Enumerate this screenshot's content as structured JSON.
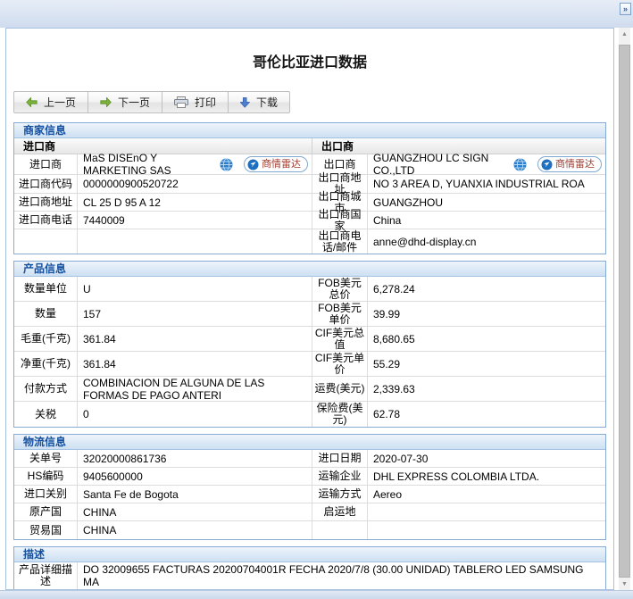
{
  "window": {
    "expand_glyph": "»"
  },
  "title": "哥伦比亚进口数据",
  "toolbar": {
    "prev_label": "上一页",
    "next_label": "下一页",
    "print_label": "打印",
    "download_label": "下载"
  },
  "merchant": {
    "section_title": "商家信息",
    "importer_group_header": "进口商",
    "exporter_group_header": "出口商",
    "radar_button_label": "商情雷达",
    "importer_rows": [
      {
        "label": "进口商",
        "value": "MaS DISEnO Y MARKETING SAS"
      },
      {
        "label": "进口商代码",
        "value": "0000000900520722"
      },
      {
        "label": "进口商地址",
        "value": "CL 25 D 95 A 12"
      },
      {
        "label": "进口商电话",
        "value": "7440009"
      }
    ],
    "exporter_rows": [
      {
        "label": "出口商",
        "value": "GUANGZHOU LC SIGN CO.,LTD"
      },
      {
        "label": "出口商地址",
        "value": "NO 3 AREA D, YUANXIA INDUSTRIAL ROA"
      },
      {
        "label": "出口商城市",
        "value": "GUANGZHOU"
      },
      {
        "label": "出口商国家",
        "value": "China"
      },
      {
        "label": "出口商电话/邮件",
        "value": "anne@dhd-display.cn"
      }
    ]
  },
  "product": {
    "section_title": "产品信息",
    "rows": [
      {
        "l1": "数量单位",
        "v1": "U",
        "l2": "FOB美元总价",
        "v2": "6,278.24"
      },
      {
        "l1": "数量",
        "v1": "157",
        "l2": "FOB美元单价",
        "v2": "39.99"
      },
      {
        "l1": "毛重(千克)",
        "v1": "361.84",
        "l2": "CIF美元总值",
        "v2": "8,680.65"
      },
      {
        "l1": "净重(千克)",
        "v1": "361.84",
        "l2": "CIF美元单价",
        "v2": "55.29"
      },
      {
        "l1": "付款方式",
        "v1": "COMBINACION DE ALGUNA DE LAS FORMAS DE PAGO ANTERI",
        "l2": "运费(美元)",
        "v2": "2,339.63"
      },
      {
        "l1": "关税",
        "v1": "0",
        "l2": "保险费(美元)",
        "v2": "62.78"
      }
    ]
  },
  "logistics": {
    "section_title": "物流信息",
    "rows": [
      {
        "l1": "关单号",
        "v1": "32020000861736",
        "l2": "进口日期",
        "v2": "2020-07-30"
      },
      {
        "l1": "HS编码",
        "v1": "9405600000",
        "l2": "运输企业",
        "v2": "DHL EXPRESS COLOMBIA LTDA."
      },
      {
        "l1": "进口关别",
        "v1": "Santa Fe de Bogota",
        "l2": "运输方式",
        "v2": "Aereo"
      },
      {
        "l1": "原产国",
        "v1": "CHINA",
        "l2": "启运地",
        "v2": ""
      },
      {
        "l1": "贸易国",
        "v1": "CHINA",
        "l2": "",
        "v2": ""
      }
    ]
  },
  "description": {
    "section_title": "描述",
    "label": "产品详细描述",
    "value": "DO 32009655 FACTURAS 20200704001R FECHA 2020/7/8 (30.00 UNIDAD) TABLERO LED SAMSUNG MA"
  },
  "icons": {
    "prev": "arrow-left-green",
    "next": "arrow-right-green",
    "print": "printer",
    "download": "arrow-down-blue",
    "company_link": "globe",
    "radar": "radar-cursor",
    "scroll_up": "▲",
    "scroll_down": "▼"
  },
  "colors": {
    "accent_blue": "#15509f",
    "section_header_bg": "#cde0f2",
    "table_border": "#86abd4",
    "radar_text": "#a03c2e",
    "green_arrow": "#7cb33a",
    "download_arrow": "#4d7fd0",
    "top_strip": "#cfdcee"
  }
}
